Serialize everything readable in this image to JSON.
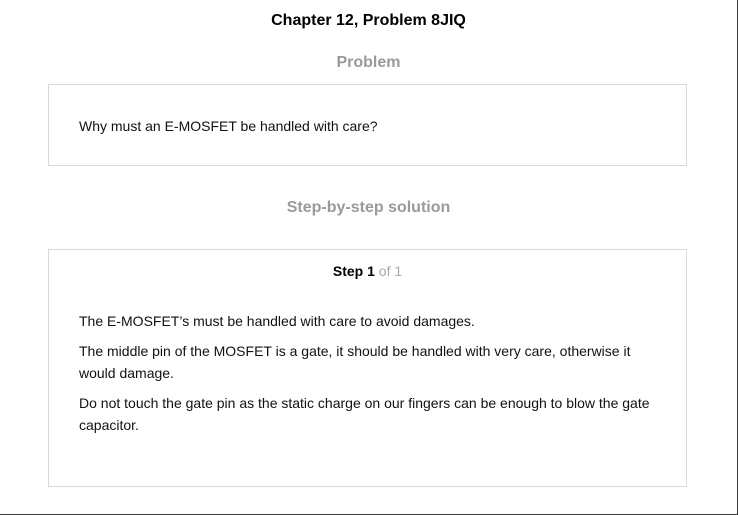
{
  "title": "Chapter 12, Problem 8JIQ",
  "problem": {
    "heading": "Problem",
    "text": "Why must an E-MOSFET be handled with care?"
  },
  "solution": {
    "heading": "Step-by-step solution",
    "step": {
      "word": "Step",
      "number": "1",
      "of_text": "of 1"
    },
    "paragraphs": [
      "The E-MOSFET’s must be handled with care to avoid damages.",
      "The middle pin of the MOSFET is a gate, it should be handled with very care, otherwise it would damage.",
      "Do not touch the gate pin as the static charge on our fingers can be enough to blow the gate capacitor."
    ]
  },
  "colors": {
    "heading_gray": "#9a9a9a",
    "border": "#d9d9d9"
  }
}
